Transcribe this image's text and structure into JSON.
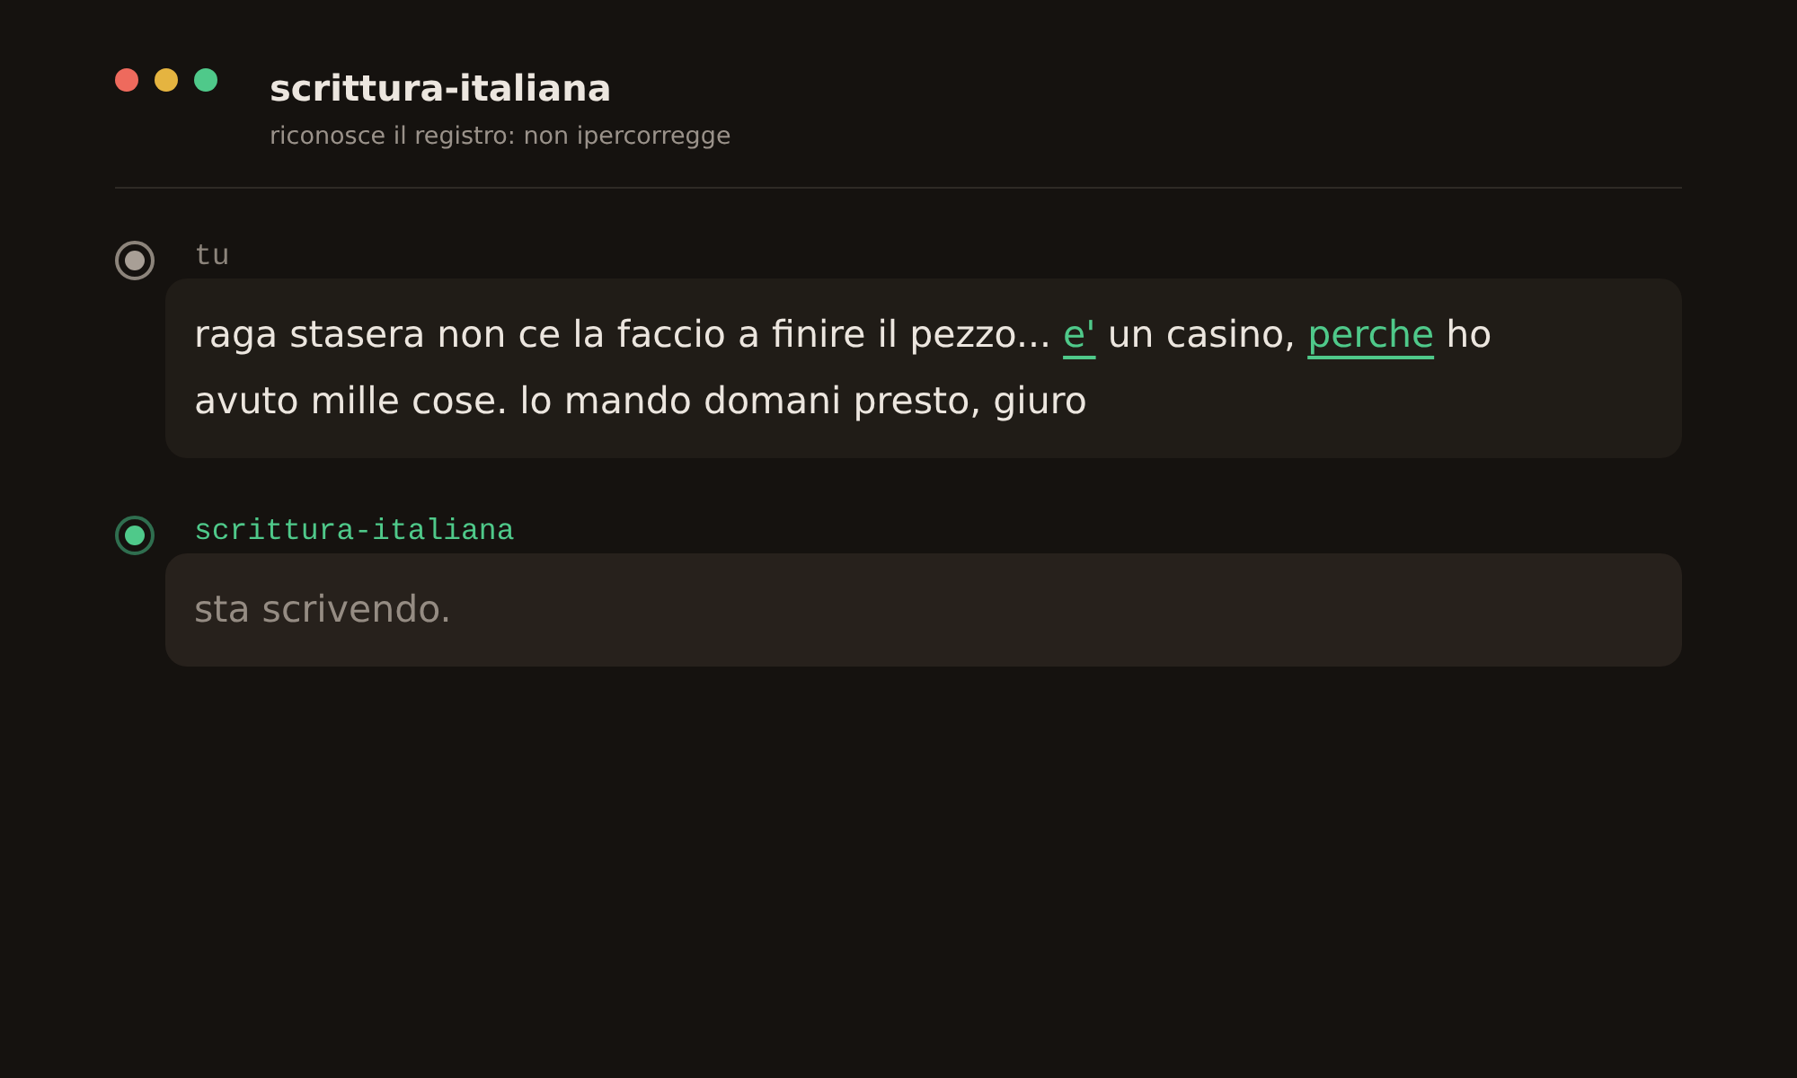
{
  "window": {
    "controls": [
      {
        "color": "#ee6a5d"
      },
      {
        "color": "#e5b440"
      },
      {
        "color": "#4fc98a"
      }
    ],
    "title": "scrittura-italiana",
    "subtitle": "riconosce il registro: non ipercorregge"
  },
  "messages": [
    {
      "kind": "user",
      "author": "tu",
      "typing": false,
      "segments": [
        {
          "text": "raga stasera non ce la faccio a finire il pezzo... ",
          "highlighted": false
        },
        {
          "text": "e'",
          "highlighted": true
        },
        {
          "text": " un casino, ",
          "highlighted": false
        },
        {
          "text": "perche",
          "highlighted": true
        },
        {
          "text": " ho avuto mille cose. lo mando domani presto, giuro",
          "highlighted": false
        }
      ]
    },
    {
      "kind": "assistant",
      "author": "scrittura-italiana",
      "typing": true,
      "segments": [
        {
          "text": "sta scrivendo.",
          "highlighted": false
        }
      ]
    }
  ]
}
